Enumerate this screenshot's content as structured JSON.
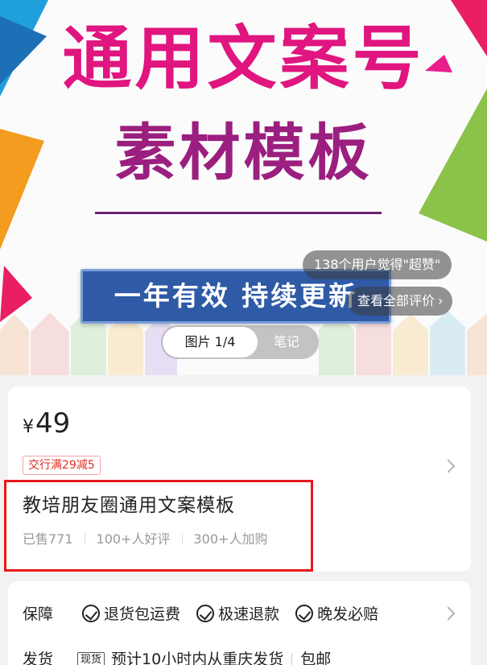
{
  "banner": {
    "title_line1": "通用文案号",
    "title_line2": "素材模板",
    "subtitle": "一年有效 持续更新",
    "praise_text": "138个用户觉得\"超赞\"",
    "reviews_link": "查看全部评价",
    "tab_images": "图片 1/4",
    "tab_notes": "笔记",
    "colors": {
      "title1": "#e0157f",
      "title2": "#9b1f7f",
      "box": "#2e5aa6"
    }
  },
  "product": {
    "currency": "¥",
    "price": "49",
    "coupon": "交行满29减5",
    "name": "教培朋友圈通用文案模板",
    "stats": {
      "sold": "已售771",
      "good_reviews": "100+人好评",
      "carts": "300+人加购"
    }
  },
  "service": {
    "guarantee_label": "保障",
    "guarantees": [
      "退货包运费",
      "极速退款",
      "晚发必赔"
    ],
    "shipping_label": "发货",
    "stock_tag": "现货",
    "shipping_text": "预计10小时内从重庆发货",
    "free_shipping": "包邮"
  },
  "icons": [
    "check-circle-icon",
    "chevron-right-icon"
  ]
}
